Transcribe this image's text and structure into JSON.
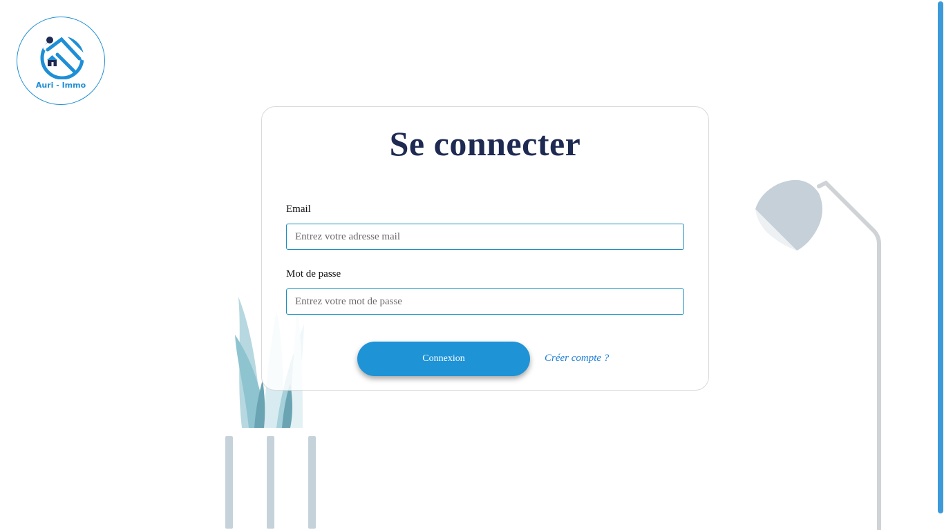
{
  "brand": {
    "name": "Auri - Immo",
    "color": "#1e8fd6"
  },
  "login": {
    "title": "Se connecter",
    "email": {
      "label": "Email",
      "placeholder": "Entrez votre adresse mail",
      "value": ""
    },
    "password": {
      "label": "Mot de passe",
      "placeholder": "Entrez votre mot de passe",
      "value": ""
    },
    "submit_label": "Connexion",
    "create_account_label": "Créer compte ?"
  },
  "colors": {
    "title": "#1e2a52",
    "button": "#1e93d6",
    "link": "#1e7fd6",
    "input_border": "#1e8fc0",
    "scrollbar": "#3d9ad9"
  },
  "decorations": {
    "left": "plant-illustration",
    "right": "floor-lamp-illustration"
  }
}
